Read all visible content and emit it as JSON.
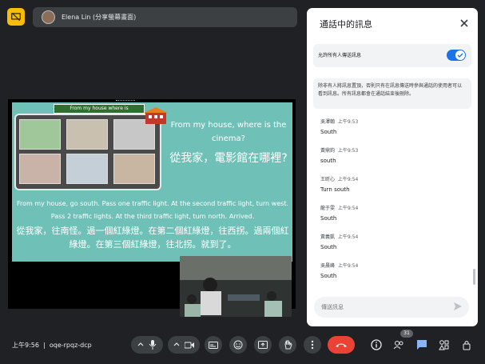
{
  "presenter": {
    "name": "Elena Lin (分享螢幕畫面)"
  },
  "slide": {
    "tag": "From my house where is",
    "question_en": "From my house, where is the cinema?",
    "question_zh": "從我家，電影館在哪裡?",
    "answer_en": "From my house, go south. Pass one traffic light. At the second traffic light, turn west. Pass 2 traffic lights. At the third traffic light, turn north. Arrived.",
    "answer_zh": "從我家，往南怪。過一個紅綠燈。在第二個紅綠燈，往西拐。過兩個紅綠燈。在第三個紅綠燈，往北拐。就到了。"
  },
  "chat": {
    "title": "通話中的訊息",
    "permission_label": "允許所有人傳送訊息",
    "permission_enabled": true,
    "notice": "除非有人將訊息置頂，否則只有在訊息傳送時參與通話的使用者可以看到訊息。所有訊息都會在通話結束後刪除。",
    "messages": [
      {
        "sender": "吳澤翰",
        "time": "上午9:53",
        "text": "South"
      },
      {
        "sender": "黃鼎鈞",
        "time": "上午9:53",
        "text": "south"
      },
      {
        "sender": "王昕心",
        "time": "上午9:54",
        "text": "Turn south"
      },
      {
        "sender": "龍于雯",
        "time": "上午9:54",
        "text": "South"
      },
      {
        "sender": "黃義凱",
        "time": "上午9:54",
        "text": "South"
      },
      {
        "sender": "吳晨峰",
        "time": "上午9:54",
        "text": "South"
      }
    ],
    "input_placeholder": "傳送訊息"
  },
  "bottom": {
    "time": "上午9:56",
    "meeting_code": "oqe-rpqz-dcp",
    "participant_count": "31"
  },
  "colors": {
    "accent": "#1a73e8",
    "end_call": "#ea4335",
    "present_badge": "#fbbc04",
    "slide_bg": "#6fc1b7"
  },
  "icons": [
    "present-to-all-icon",
    "mic-icon",
    "chevron-up-icon",
    "camera-icon",
    "captions-icon",
    "emoji-icon",
    "present-icon",
    "raise-hand-icon",
    "more-vert-icon",
    "end-call-icon",
    "info-icon",
    "people-icon",
    "chat-icon",
    "activities-icon",
    "host-controls-icon",
    "close-icon",
    "send-icon",
    "check-icon"
  ]
}
